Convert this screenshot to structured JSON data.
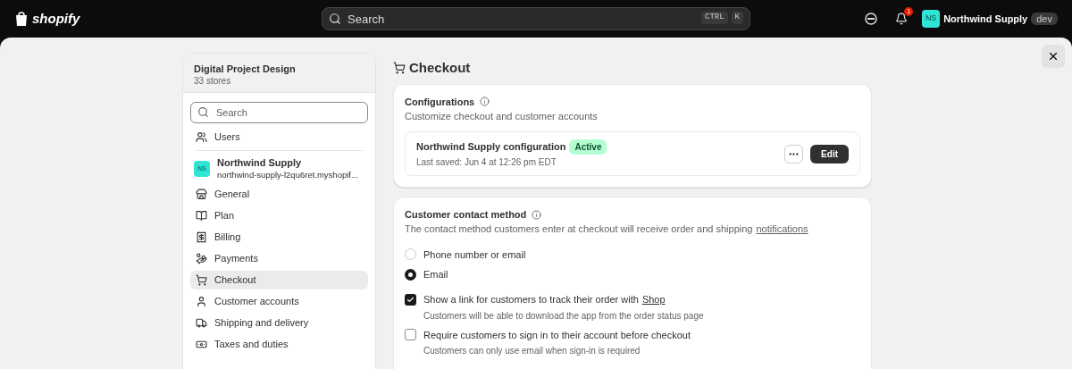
{
  "topbar": {
    "logo": "shopify",
    "search": {
      "placeholder": "Search",
      "keys": [
        "CTRL",
        "K"
      ]
    },
    "notification_count": "1",
    "store": {
      "initials": "NS",
      "name": "Northwind Supply",
      "badge": "dev"
    }
  },
  "sidebar": {
    "org": "Digital Project Design",
    "org_sub": "33 stores",
    "search": {
      "placeholder": "Search"
    },
    "users": "Users",
    "store": {
      "initials": "NS",
      "name": "Northwind Supply",
      "domain": "northwind-supply-l2qu6ret.myshopif..."
    },
    "items": [
      {
        "label": "General",
        "kind": "store",
        "selected": false
      },
      {
        "label": "Plan",
        "kind": "plan",
        "selected": false
      },
      {
        "label": "Billing",
        "kind": "billing",
        "selected": false
      },
      {
        "label": "Payments",
        "kind": "payments",
        "selected": false
      },
      {
        "label": "Checkout",
        "kind": "cart",
        "selected": true
      },
      {
        "label": "Customer accounts",
        "kind": "person",
        "selected": false
      },
      {
        "label": "Shipping and delivery",
        "kind": "truck",
        "selected": false
      },
      {
        "label": "Taxes and duties",
        "kind": "bag",
        "selected": false
      }
    ]
  },
  "page": {
    "title": "Checkout",
    "configurations": {
      "title": "Configurations",
      "subtitle": "Customize checkout and customer accounts",
      "config": {
        "name": "Northwind Supply configuration",
        "status": "Active",
        "saved": "Last saved: Jun 4 at 12:26 pm EDT",
        "edit": "Edit"
      }
    },
    "contact": {
      "title": "Customer contact method",
      "description": "The contact method customers enter at checkout will receive order and shipping",
      "description_link": "notifications",
      "options": [
        {
          "label": "Phone number or email",
          "selected": false
        },
        {
          "label": "Email",
          "selected": true
        }
      ],
      "checkboxes": [
        {
          "label": "Show a link for customers to track their order with",
          "link": "Shop",
          "help": "Customers will be able to download the app from the order status page",
          "checked": true
        },
        {
          "label": "Require customers to sign in to their account before checkout",
          "help": "Customers can only use email when sign-in is required",
          "checked": false
        }
      ]
    }
  }
}
